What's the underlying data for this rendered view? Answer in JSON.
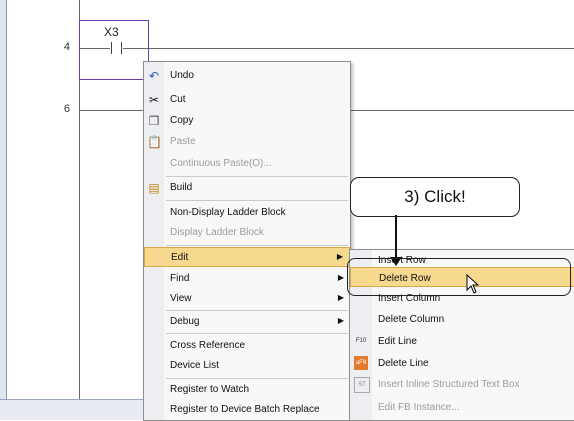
{
  "ladder": {
    "rungs": [
      {
        "number": "4"
      },
      {
        "number": "6"
      }
    ],
    "contact_device": "X3"
  },
  "context_menu": {
    "items": [
      {
        "label": "Undo",
        "icon": "undo-icon",
        "disabled": false
      },
      {
        "label": "Cut",
        "icon": "cut-icon",
        "disabled": false
      },
      {
        "label": "Copy",
        "icon": "copy-icon",
        "disabled": false
      },
      {
        "label": "Paste",
        "icon": "paste-icon",
        "disabled": true
      },
      {
        "label": "Continuous Paste(O)...",
        "disabled": true
      },
      {
        "label": "Build",
        "icon": "build-icon",
        "disabled": false
      },
      {
        "label": "Non-Display Ladder Block",
        "disabled": false
      },
      {
        "label": "Display Ladder Block",
        "disabled": true
      },
      {
        "label": "Edit",
        "submenu": true,
        "highlighted": true
      },
      {
        "label": "Find",
        "submenu": true
      },
      {
        "label": "View",
        "submenu": true
      },
      {
        "label": "Debug",
        "submenu": true
      },
      {
        "label": "Cross Reference"
      },
      {
        "label": "Device List"
      },
      {
        "label": "Register to Watch"
      },
      {
        "label": "Register to Device Batch Replace"
      }
    ]
  },
  "edit_submenu": {
    "items": [
      {
        "label": "Insert Row"
      },
      {
        "label": "Delete Row",
        "highlighted": true
      },
      {
        "label": "Insert Column"
      },
      {
        "label": "Delete Column"
      },
      {
        "label": "Edit Line",
        "icon_text": "F10"
      },
      {
        "label": "Delete Line",
        "icon_text": "aF9"
      },
      {
        "label": "Insert Inline Structured Text Box",
        "disabled": true,
        "icon_text": "ST"
      },
      {
        "label": "Edit FB Instance...",
        "disabled": true
      }
    ]
  },
  "callout": {
    "text": "3) Click!"
  },
  "colors": {
    "highlight": "#f6d88e",
    "selection": "#6b3fae"
  }
}
